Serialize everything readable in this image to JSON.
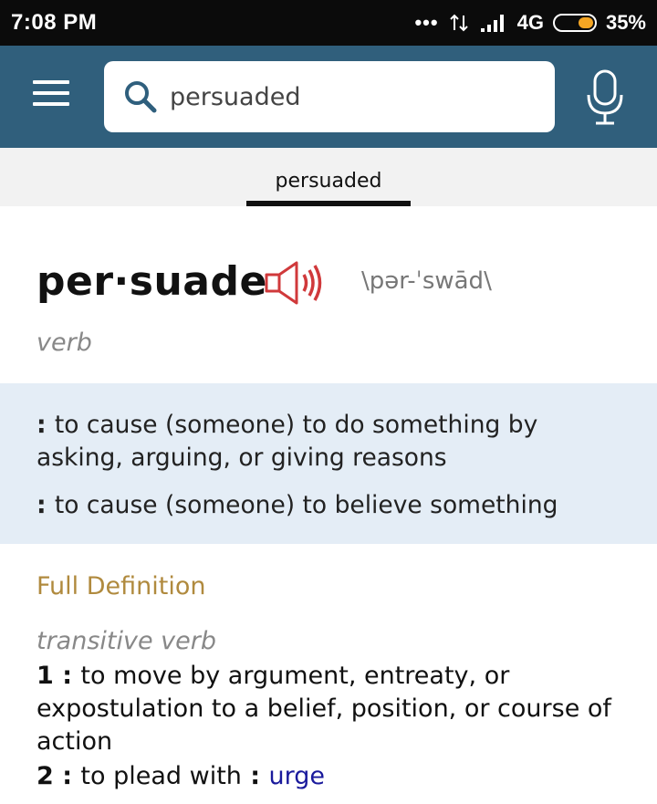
{
  "status": {
    "time": "7:08 PM",
    "network": "4G",
    "battery": "35%"
  },
  "search": {
    "value": "persuaded"
  },
  "tabs": [
    {
      "label": "persuaded",
      "active": true
    }
  ],
  "entry": {
    "headword": "per·suade",
    "pronunciation": "\\pər-ˈswād\\",
    "part_of_speech": "verb",
    "short_definitions": [
      "to cause (someone) to do something by asking, arguing, or giving reasons",
      "to cause (someone) to believe something"
    ],
    "full_definition": {
      "title": "Full Definition",
      "label": "transitive verb",
      "senses": [
        {
          "number": "1",
          "text": "to move by argument, entreaty, or expostulation to a belief, position, or course of action"
        },
        {
          "number": "2",
          "text": "to plead with",
          "synonym": "urge"
        }
      ]
    }
  },
  "colors": {
    "app_bar": "#305f7c",
    "short_def_bg": "#e4edf6",
    "full_def_title": "#b08a3e",
    "speaker": "#d0393b",
    "link": "#1a1a9c"
  },
  "icons": {
    "menu": "hamburger-menu-icon",
    "search": "search-icon",
    "mic": "microphone-icon",
    "speaker": "speaker-audio-icon"
  }
}
